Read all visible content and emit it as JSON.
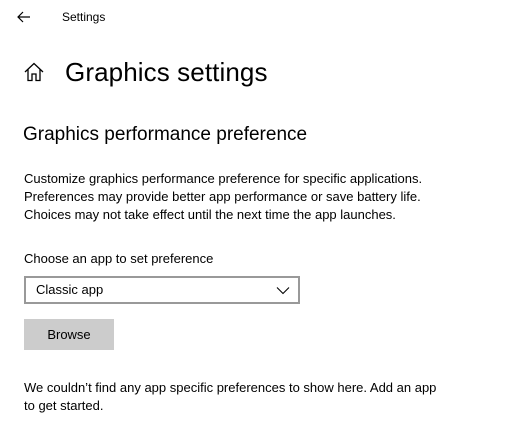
{
  "window": {
    "title": "Settings"
  },
  "page": {
    "title": "Graphics settings"
  },
  "section": {
    "title": "Graphics performance preference",
    "description_lines": [
      "Customize graphics performance preference for specific applications.",
      "Preferences may provide better app performance or save battery life.",
      "Choices may not take effect until the next time the app launches."
    ]
  },
  "app_picker": {
    "label": "Choose an app to set preference",
    "selected": "Classic app",
    "browse_label": "Browse"
  },
  "empty_state": {
    "lines": [
      "We couldn’t find any app specific preferences to show here. Add an app",
      "to get started."
    ]
  },
  "icons": {
    "back": "back-arrow-icon",
    "home": "home-icon",
    "dropdown": "chevron-down-icon"
  },
  "colors": {
    "background": "#ffffff",
    "text": "#000000",
    "button_bg": "#cccccc",
    "input_border": "#999999"
  }
}
